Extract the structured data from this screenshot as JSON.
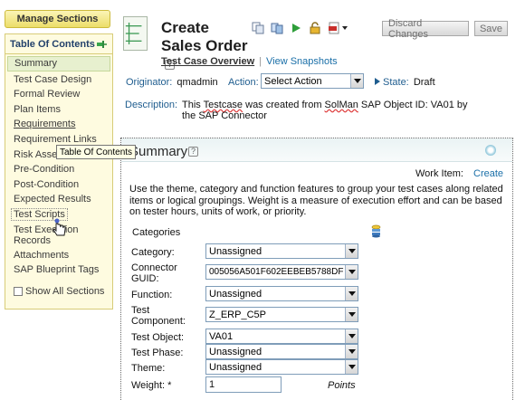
{
  "sidebar": {
    "manage_sections": "Manage Sections",
    "toc_title": "Table Of Contents",
    "items": [
      {
        "label": "Summary"
      },
      {
        "label": "Test Case Design"
      },
      {
        "label": "Formal Review"
      },
      {
        "label": "Plan Items"
      },
      {
        "label": "Requirements"
      },
      {
        "label": "Requirement Links"
      },
      {
        "label": "Risk Assessment"
      },
      {
        "label": "Pre-Condition"
      },
      {
        "label": "Post-Condition"
      },
      {
        "label": "Expected Results"
      },
      {
        "label": "Test Scripts"
      },
      {
        "label": "Test Execution Records"
      },
      {
        "label": "Attachments"
      },
      {
        "label": "SAP Blueprint Tags"
      }
    ],
    "show_all": "Show All Sections",
    "tooltip": "Table Of Contents"
  },
  "header": {
    "title": "Create Sales Order",
    "help": "?",
    "discard_label": "Discard Changes",
    "save_label": "Save",
    "tabs": {
      "overview": "Test Case Overview",
      "separator": "|",
      "snapshots": "View Snapshots"
    }
  },
  "meta": {
    "originator_label": "Originator:",
    "originator_value": "qmadmin",
    "action_label": "Action:",
    "action_value": "Select Action",
    "state_label": "State:",
    "state_value": "Draft",
    "description_label": "Description:",
    "description_pre": "This ",
    "description_testcase": "Testcase",
    "description_mid": " was created from ",
    "description_solman": "SolMan",
    "description_post": " SAP Object ID: VA01 by the SAP Connector"
  },
  "summary": {
    "title": "Summary",
    "help": "?",
    "work_item_label": "Work Item:",
    "work_item_link": "Create",
    "description": "Use the theme, category and function features to group your test cases along related items or logical groupings. Weight is a measure of execution effort and can be based on tester hours, units of work, or priority.",
    "categories_label": "Categories",
    "fields": {
      "category": {
        "label": "Category:",
        "value": "Unassigned"
      },
      "connector_guid": {
        "label": "Connector GUID:",
        "value": "005056A501F602EEBEB5788DF"
      },
      "function": {
        "label": "Function:",
        "value": "Unassigned"
      },
      "test_component": {
        "label": "Test Component:",
        "value": "Z_ERP_C5P"
      },
      "test_object": {
        "label": "Test Object:",
        "value": "VA01"
      },
      "test_phase": {
        "label": "Test Phase:",
        "value": "Unassigned"
      },
      "theme": {
        "label": "Theme:",
        "value": "Unassigned"
      },
      "weight": {
        "label": "Weight: *",
        "value": "1",
        "unit": "Points"
      }
    }
  }
}
